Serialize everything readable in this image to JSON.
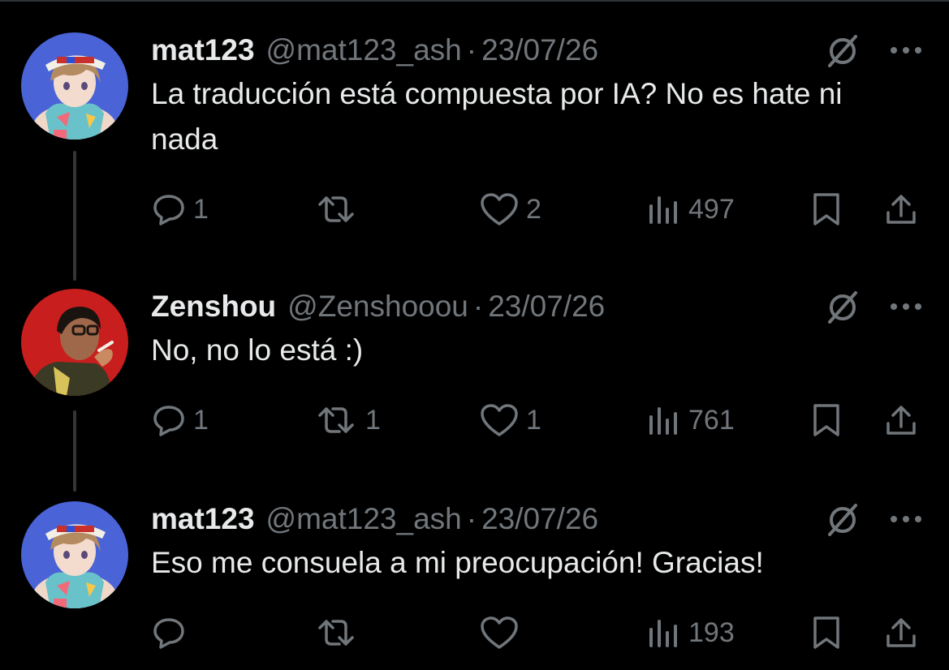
{
  "posts": [
    {
      "display_name": "mat123",
      "handle": "@mat123_ash",
      "separator": "·",
      "date": "23/07/26",
      "text": "La traducción está compuesta por IA? No es hate ni nada",
      "avatar": "anime-girl-avatar",
      "replies": "1",
      "reposts": "",
      "likes": "2",
      "views": "497"
    },
    {
      "display_name": "Zenshou",
      "handle": "@Zenshooou",
      "separator": "·",
      "date": "23/07/26",
      "text": "No, no lo está :)",
      "avatar": "smoking-man-avatar",
      "replies": "1",
      "reposts": "1",
      "likes": "1",
      "views": "761"
    },
    {
      "display_name": "mat123",
      "handle": "@mat123_ash",
      "separator": "·",
      "date": "23/07/26",
      "text": "Eso me consuela a mi preocupación! Gracias!",
      "avatar": "anime-girl-avatar",
      "replies": "",
      "reposts": "",
      "likes": "",
      "views": "193"
    }
  ],
  "colors": {
    "background": "#000000",
    "primary_text": "#e7e9ea",
    "secondary_text": "#71767b",
    "thread_line": "#333639"
  },
  "icons": [
    "reply-icon",
    "repost-icon",
    "like-icon",
    "views-icon",
    "bookmark-icon",
    "share-icon",
    "grok-icon",
    "more-icon"
  ]
}
